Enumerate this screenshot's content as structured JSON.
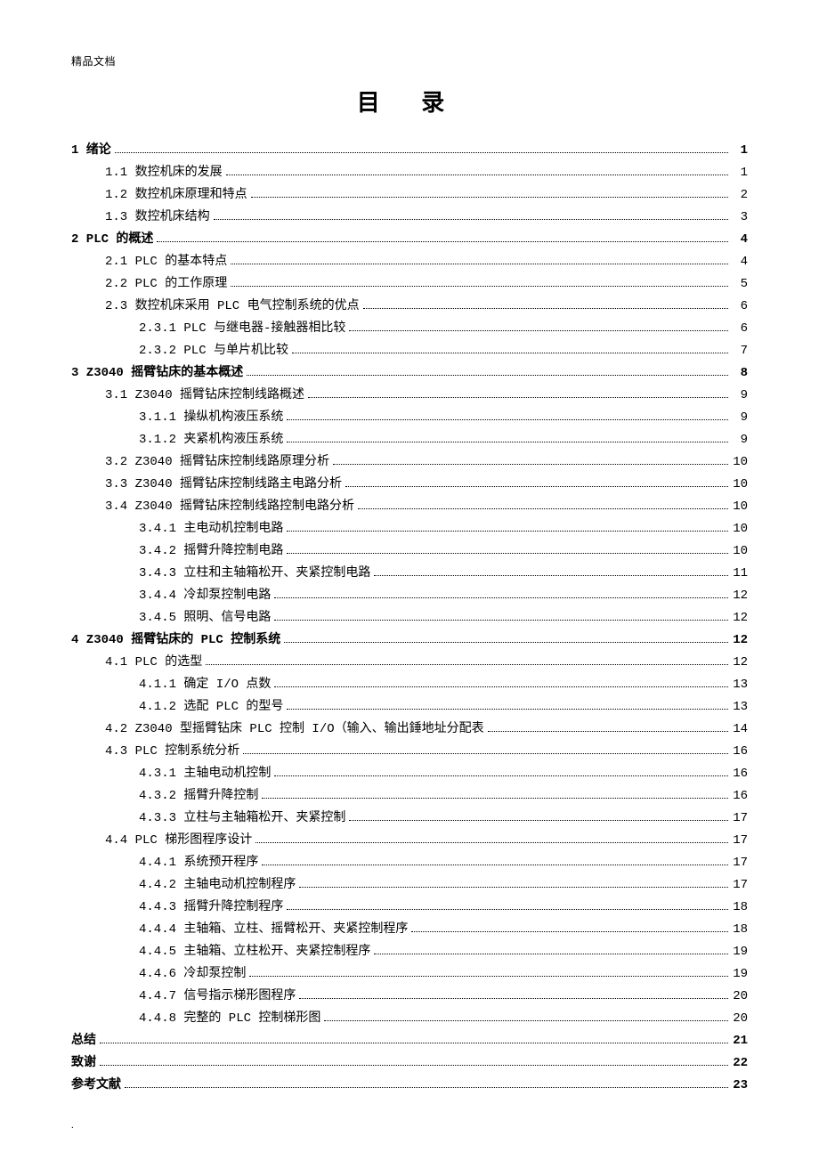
{
  "header_note": "精品文档",
  "title": "目 录",
  "footer_mark": ".",
  "toc": [
    {
      "indent": 0,
      "label": "1 绪论",
      "page": "1"
    },
    {
      "indent": 1,
      "label": "1.1 数控机床的发展",
      "page": "1"
    },
    {
      "indent": 1,
      "label": "1.2 数控机床原理和特点",
      "page": "2"
    },
    {
      "indent": 1,
      "label": "1.3 数控机床结构",
      "page": "3"
    },
    {
      "indent": 0,
      "label": "2 PLC 的概述",
      "page": "4"
    },
    {
      "indent": 1,
      "label": "2.1 PLC 的基本特点",
      "page": "4"
    },
    {
      "indent": 1,
      "label": "2.2 PLC 的工作原理",
      "page": "5"
    },
    {
      "indent": 1,
      "label": "2.3 数控机床采用 PLC 电气控制系统的优点",
      "page": "6"
    },
    {
      "indent": 2,
      "label": "2.3.1 PLC 与继电器-接触器相比较",
      "page": "6"
    },
    {
      "indent": 2,
      "label": "2.3.2 PLC 与单片机比较",
      "page": "7"
    },
    {
      "indent": 0,
      "label": "3 Z3040 摇臂钻床的基本概述",
      "page": "8"
    },
    {
      "indent": 1,
      "label": "3.1 Z3040 摇臂钻床控制线路概述",
      "page": "9"
    },
    {
      "indent": 2,
      "label": "3.1.1 操纵机构液压系统",
      "page": "9"
    },
    {
      "indent": 2,
      "label": "3.1.2 夹紧机构液压系统",
      "page": "9"
    },
    {
      "indent": 1,
      "label": "3.2 Z3040 摇臂钻床控制线路原理分析",
      "page": "10"
    },
    {
      "indent": 1,
      "label": "3.3 Z3040 摇臂钻床控制线路主电路分析",
      "page": "10"
    },
    {
      "indent": 1,
      "label": "3.4 Z3040 摇臂钻床控制线路控制电路分析",
      "page": "10"
    },
    {
      "indent": 2,
      "label": "3.4.1 主电动机控制电路",
      "page": "10"
    },
    {
      "indent": 2,
      "label": "3.4.2 摇臂升降控制电路",
      "page": "10"
    },
    {
      "indent": 2,
      "label": "3.4.3 立柱和主轴箱松开、夹紧控制电路",
      "page": "11"
    },
    {
      "indent": 2,
      "label": "3.4.4 冷却泵控制电路",
      "page": "12"
    },
    {
      "indent": 2,
      "label": "3.4.5 照明、信号电路",
      "page": "12"
    },
    {
      "indent": 0,
      "label": "4 Z3040 摇臂钻床的 PLC 控制系统",
      "page": "12"
    },
    {
      "indent": 1,
      "label": "4.1 PLC 的选型",
      "page": "12"
    },
    {
      "indent": 2,
      "label": "4.1.1 确定 I/O 点数",
      "page": "13"
    },
    {
      "indent": 2,
      "label": "4.1.2 选配 PLC 的型号",
      "page": "13"
    },
    {
      "indent": 1,
      "label": "4.2 Z3040 型摇臂钻床 PLC 控制 I/O（输入、输出錘地址分配表",
      "page": "14"
    },
    {
      "indent": 1,
      "label": "4.3 PLC 控制系统分析",
      "page": "16"
    },
    {
      "indent": 2,
      "label": "4.3.1 主轴电动机控制",
      "page": "16"
    },
    {
      "indent": 2,
      "label": "4.3.2 摇臂升降控制",
      "page": "16"
    },
    {
      "indent": 2,
      "label": "4.3.3 立柱与主轴箱松开、夹紧控制",
      "page": "17"
    },
    {
      "indent": 1,
      "label": "4.4 PLC 梯形图程序设计",
      "page": "17"
    },
    {
      "indent": 2,
      "label": "4.4.1 系统预开程序",
      "page": "17"
    },
    {
      "indent": 2,
      "label": "4.4.2 主轴电动机控制程序",
      "page": "17"
    },
    {
      "indent": 2,
      "label": "4.4.3 摇臂升降控制程序",
      "page": "18"
    },
    {
      "indent": 2,
      "label": "4.4.4 主轴箱、立柱、摇臂松开、夹紧控制程序",
      "page": "18"
    },
    {
      "indent": 2,
      "label": "4.4.5 主轴箱、立柱松开、夹紧控制程序",
      "page": "19"
    },
    {
      "indent": 2,
      "label": "4.4.6 冷却泵控制",
      "page": "19"
    },
    {
      "indent": 2,
      "label": "4.4.7 信号指示梯形图程序",
      "page": "20"
    },
    {
      "indent": 2,
      "label": "4.4.8 完整的 PLC 控制梯形图",
      "page": "20"
    },
    {
      "indent": 0,
      "label": "总结",
      "page": "21"
    },
    {
      "indent": 0,
      "label": "致谢",
      "page": "22"
    },
    {
      "indent": 0,
      "label": "参考文献",
      "page": "23"
    }
  ]
}
